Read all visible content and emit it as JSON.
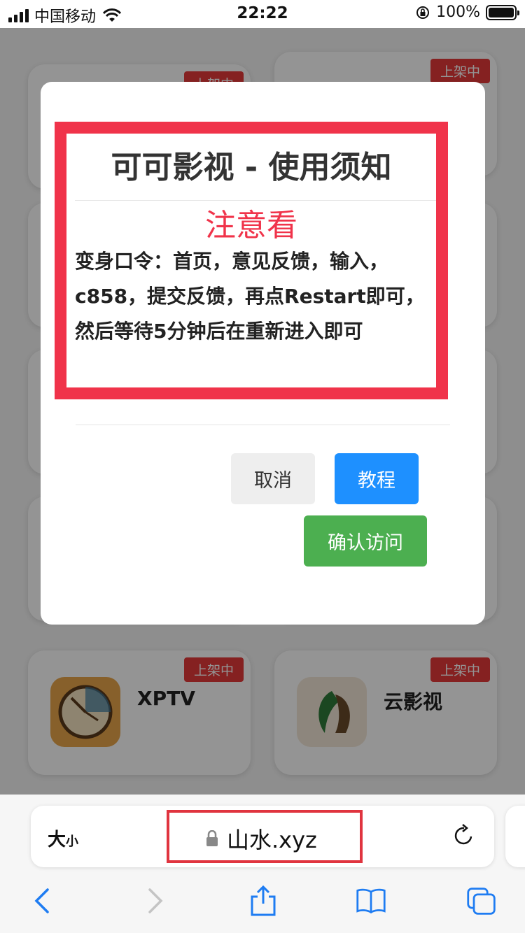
{
  "status_bar": {
    "carrier": "中国移动",
    "time": "22:22",
    "battery": "100%"
  },
  "background_cards": [
    {
      "badge": "上架中",
      "name": ""
    },
    {
      "badge": "上架中",
      "name": ""
    },
    {
      "badge": "上架中",
      "name": "XPTV"
    },
    {
      "badge": "上架中",
      "name": "云影视"
    }
  ],
  "modal": {
    "title": "可可影视 - 使用须知",
    "subtitle": "注意看",
    "body": "变身口令：首页，意见反馈，输入，c858，提交反馈，再点Restart即可，然后等待5分钟后在重新进入即可",
    "cancel_label": "取消",
    "tutorial_label": "教程",
    "confirm_label": "确认访问"
  },
  "browser": {
    "text_size_label": "大",
    "text_size_small": "小",
    "url": "山水.xyz"
  },
  "colors": {
    "highlight_red": "#f0334a",
    "primary_blue": "#1e90ff",
    "confirm_green": "#4caf50",
    "badge_red": "#e63a3a"
  }
}
